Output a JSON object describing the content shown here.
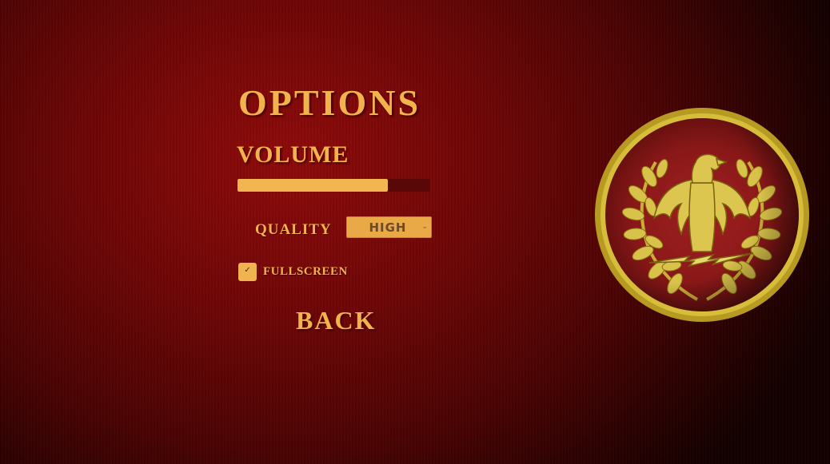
{
  "menu": {
    "title": "OPTIONS",
    "volume": {
      "label": "VOLUME",
      "level": 0.78
    },
    "quality": {
      "label": "QUALITY",
      "selected": "HIGH"
    },
    "fullscreen": {
      "label": "FULLSCREEN",
      "checked": true,
      "check_glyph": "✓"
    },
    "back_label": "BACK"
  },
  "emblem": {
    "icon": "roman-eagle-emblem-icon"
  },
  "colors": {
    "gold": "#f2b34c",
    "background_red": "#8e0a0a",
    "track": "#5a0707"
  }
}
